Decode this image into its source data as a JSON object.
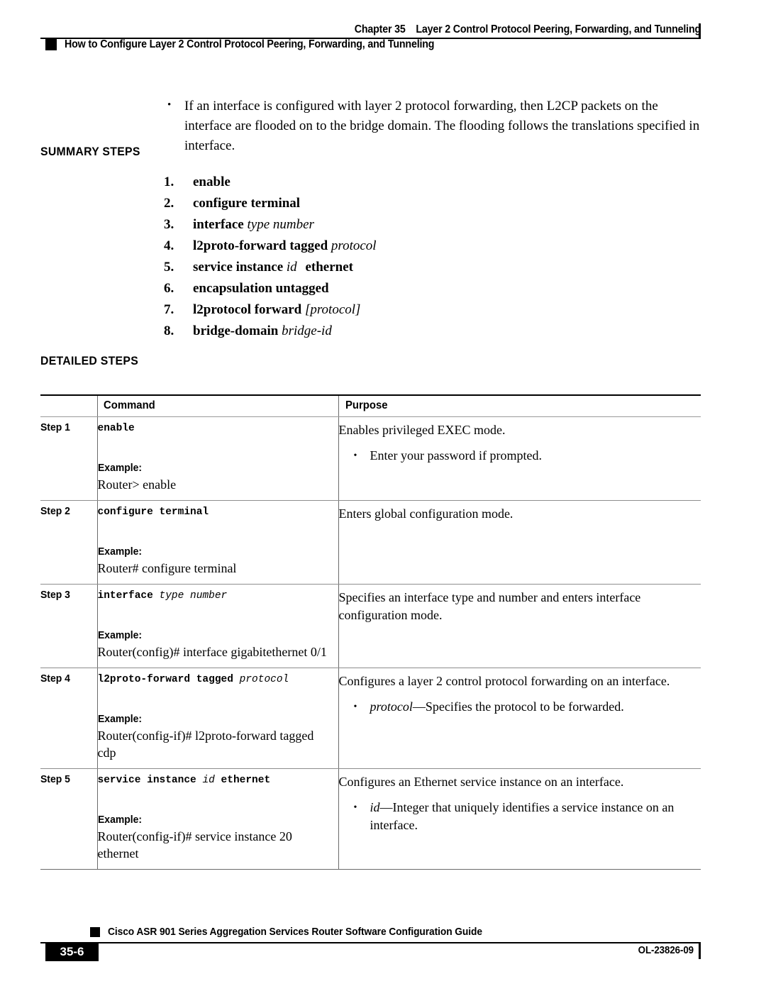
{
  "header": {
    "chapter": "Chapter 35",
    "chapter_title": "Layer 2 Control Protocol Peering, Forwarding, and Tunneling",
    "section_title": "How to Configure Layer 2 Control Protocol Peering, Forwarding, and Tunneling"
  },
  "intro": {
    "bullet": "If an interface is configured with layer 2 protocol forwarding, then L2CP packets on the interface are flooded on to the bridge domain. The flooding follows the translations specified in interface."
  },
  "summary": {
    "heading": "SUMMARY STEPS",
    "steps": [
      {
        "num": "1.",
        "cmd": "enable",
        "arg": ""
      },
      {
        "num": "2.",
        "cmd": "configure terminal",
        "arg": ""
      },
      {
        "num": "3.",
        "cmd": "interface",
        "arg": "type number"
      },
      {
        "num": "4.",
        "cmd": "l2proto-forward tagged",
        "arg": "protocol"
      },
      {
        "num": "5.",
        "cmd": "service instance",
        "arg": "id",
        "cmd2": "ethernet"
      },
      {
        "num": "6.",
        "cmd": "encapsulation untagged",
        "arg": ""
      },
      {
        "num": "7.",
        "cmd": "l2protocol forward",
        "arg": "[protocol]"
      },
      {
        "num": "8.",
        "cmd": "bridge-domain",
        "arg": "bridge-id"
      }
    ]
  },
  "detailed": {
    "heading": "DETAILED STEPS",
    "columns": {
      "step": "",
      "command": "Command",
      "purpose": "Purpose"
    },
    "example_label": "Example:",
    "rows": [
      {
        "step": "Step 1",
        "command": "enable",
        "command_arg": "",
        "example": "Router> enable",
        "purpose": "Enables privileged EXEC mode.",
        "bullets": [
          {
            "italic": "",
            "text": "Enter your password if prompted."
          }
        ]
      },
      {
        "step": "Step 2",
        "command": "configure terminal",
        "command_arg": "",
        "example": "Router# configure terminal",
        "purpose": "Enters global configuration mode.",
        "bullets": []
      },
      {
        "step": "Step 3",
        "command": "interface",
        "command_arg": "type number",
        "example": "Router(config)# interface gigabitethernet 0/1",
        "purpose": "Specifies an interface type and number and enters interface configuration mode.",
        "bullets": []
      },
      {
        "step": "Step 4",
        "command": "l2proto-forward tagged",
        "command_arg": "protocol",
        "example": "Router(config-if)# l2proto-forward tagged cdp",
        "purpose": "Configures a layer 2 control protocol forwarding on an interface.",
        "bullets": [
          {
            "italic": "protocol",
            "text": "—Specifies the protocol to be forwarded."
          }
        ]
      },
      {
        "step": "Step 5",
        "command": "service instance",
        "command_arg": "id",
        "command_tail": "ethernet",
        "example": "Router(config-if)# service instance 20 ethernet",
        "purpose": "Configures an Ethernet service instance on an interface.",
        "bullets": [
          {
            "italic": "id",
            "text": "—Integer that uniquely identifies a service instance on an interface."
          }
        ]
      }
    ]
  },
  "footer": {
    "guide_title": "Cisco ASR 901 Series Aggregation Services Router Software Configuration Guide",
    "page_number": "35-6",
    "doc_id": "OL-23826-09"
  }
}
